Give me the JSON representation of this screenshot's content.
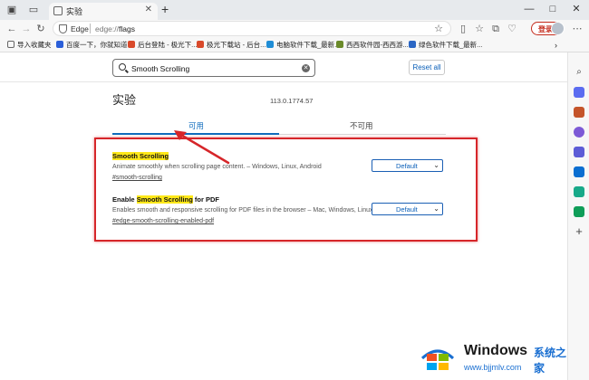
{
  "browser": {
    "tab_title": "实验",
    "url_scheme": "edge://",
    "url_path": "flags",
    "site_label": "Edge",
    "login_label": "登录"
  },
  "favorites": [
    {
      "label": "导入收藏夹",
      "color": "#f0b400"
    },
    {
      "label": "百度一下，你就知道",
      "color": "#2b5fd9"
    },
    {
      "label": "后台登陆 - 极光下...",
      "color": "#d94a2b"
    },
    {
      "label": "极光下载站 - 后台...",
      "color": "#d94a2b"
    },
    {
      "label": "电脑软件下载_最新...",
      "color": "#1f8dd6"
    },
    {
      "label": "西西软件园-西西游...",
      "color": "#6b8a2a"
    },
    {
      "label": "绿色软件下载_最新...",
      "color": "#2a66c4"
    }
  ],
  "search": {
    "value": "Smooth Scrolling",
    "reset_label": "Reset all"
  },
  "page": {
    "title": "实验",
    "version": "113.0.1774.57",
    "tab_available": "可用",
    "tab_unavailable": "不可用"
  },
  "flags": [
    {
      "name_prefix": "",
      "name_highlight": "Smooth Scrolling",
      "name_suffix": "",
      "description": "Animate smoothly when scrolling page content. – Windows, Linux, Android",
      "link": "#smooth-scrolling",
      "value": "Default"
    },
    {
      "name_prefix": "Enable ",
      "name_highlight": "Smooth Scrolling",
      "name_suffix": " for PDF",
      "description": "Enables smooth and responsive scrolling for PDF files in the browser – Mac, Windows, Linux",
      "link": "#edge-smooth-scrolling-enabled-pdf",
      "value": "Default"
    }
  ],
  "watermark": {
    "brand": "Windows",
    "brand_cn": "系统之家",
    "site": "www.bjjmlv.com"
  },
  "colors": {
    "accent": "#0f6cbd",
    "annotation": "#d6262a",
    "highlight": "#ffe819"
  }
}
